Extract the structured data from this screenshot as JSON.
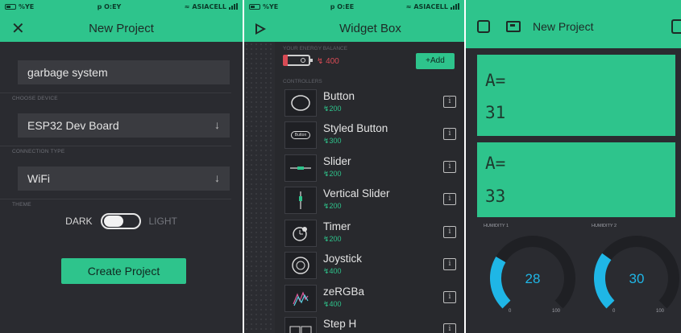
{
  "colors": {
    "accent": "#2ec48c",
    "background": "#2a2b30",
    "danger": "#d84b55",
    "gauge_fill": "#1fb6e6"
  },
  "status_bar": {
    "p1": {
      "left": "%YE",
      "center": "p O:EY",
      "right": "ASIACELL"
    },
    "p2": {
      "left": "%YE",
      "center": "p O:EE",
      "right": "ASIACELL"
    }
  },
  "new_project": {
    "title": "New Project",
    "close_icon": "close-icon",
    "project_name": "garbage system",
    "choose_device_label": "CHOOSE DEVICE",
    "device": "ESP32 Dev Board",
    "connection_label": "CONNECTION TYPE",
    "connection": "WiFi",
    "theme_label": "THEME",
    "theme_dark": "DARK",
    "theme_light": "LIGHT",
    "theme_is_light": false,
    "create_button": "Create Project"
  },
  "widget_box": {
    "title": "Widget Box",
    "energy_label": "YOUR ENERGY BALANCE",
    "energy_value": "400",
    "add_button": "+Add",
    "controllers_label": "CONTROLLERS",
    "widgets": [
      {
        "name": "Button",
        "cost": "200",
        "icon": "button-widget-icon"
      },
      {
        "name": "Styled Button",
        "cost": "300",
        "icon": "styled-button-widget-icon",
        "thumb_text": "Button"
      },
      {
        "name": "Slider",
        "cost": "200",
        "icon": "slider-widget-icon"
      },
      {
        "name": "Vertical Slider",
        "cost": "200",
        "icon": "vertical-slider-widget-icon"
      },
      {
        "name": "Timer",
        "cost": "200",
        "icon": "timer-widget-icon"
      },
      {
        "name": "Joystick",
        "cost": "400",
        "icon": "joystick-widget-icon"
      },
      {
        "name": "zeRGBa",
        "cost": "400",
        "icon": "zergba-widget-icon"
      },
      {
        "name": "Step H",
        "cost": "",
        "icon": "step-h-widget-icon"
      }
    ]
  },
  "dashboard": {
    "title": "New Project",
    "displays": [
      {
        "label": "A=",
        "value": "31"
      },
      {
        "label": "A=",
        "value": "33"
      }
    ],
    "gauges": [
      {
        "label": "HUMIDITY 1",
        "value": 28,
        "min": 0,
        "max": 100
      },
      {
        "label": "HUMIDITY 2",
        "value": 30,
        "min": 0,
        "max": 100
      }
    ]
  }
}
